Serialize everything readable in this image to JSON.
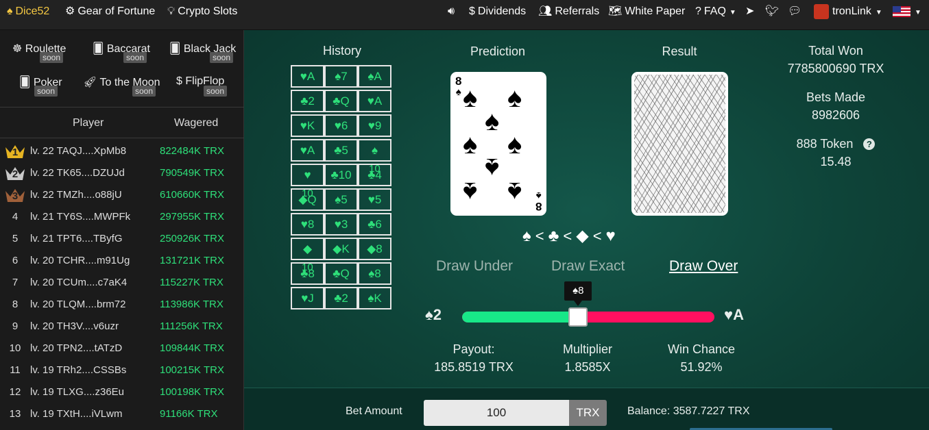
{
  "nav": {
    "brand": "Dice52",
    "gear": "Gear of Fortune",
    "crypto": "Crypto Slots",
    "dividends": "Dividends",
    "referrals": "Referrals",
    "whitepaper": "White Paper",
    "faq": "FAQ",
    "wallet": "tronLink"
  },
  "games": [
    {
      "label": "Roulette",
      "badge": "soon"
    },
    {
      "label": "Baccarat",
      "badge": "soon"
    },
    {
      "label": "Black Jack",
      "badge": "soon"
    },
    {
      "label": "Poker",
      "badge": "soon"
    },
    {
      "label": "To the Moon",
      "badge": "soon"
    },
    {
      "label": "FlipFlop",
      "badge": "soon"
    }
  ],
  "leaderboard": {
    "col_player": "Player",
    "col_wagered": "Wagered",
    "rows": [
      {
        "rank": "1",
        "player": "lv. 22 TAQJ....XpMb8",
        "wagered": "822484K TRX"
      },
      {
        "rank": "2",
        "player": "lv. 22 TK65....DZUJd",
        "wagered": "790549K TRX"
      },
      {
        "rank": "3",
        "player": "lv. 22 TMZh....o88jU",
        "wagered": "610660K TRX"
      },
      {
        "rank": "4",
        "player": "lv. 21 TY6S....MWPFk",
        "wagered": "297955K TRX"
      },
      {
        "rank": "5",
        "player": "lv. 21 TPT6....TByfG",
        "wagered": "250926K TRX"
      },
      {
        "rank": "6",
        "player": "lv. 20 TCHR....m91Ug",
        "wagered": "131721K TRX"
      },
      {
        "rank": "7",
        "player": "lv. 20 TCUm....c7aK4",
        "wagered": "115227K TRX"
      },
      {
        "rank": "8",
        "player": "lv. 20 TLQM....brm72",
        "wagered": "113986K TRX"
      },
      {
        "rank": "9",
        "player": "lv. 20 TH3V....v6uzr",
        "wagered": "111256K TRX"
      },
      {
        "rank": "10",
        "player": "lv. 20 TPN2....tATzD",
        "wagered": "109844K TRX"
      },
      {
        "rank": "11",
        "player": "lv. 19 TRh2....CSSBs",
        "wagered": "100215K TRX"
      },
      {
        "rank": "12",
        "player": "lv. 19 TLXG....z36Eu",
        "wagered": "100198K TRX"
      },
      {
        "rank": "13",
        "player": "lv. 19 TXtH....iVLwm",
        "wagered": "91166K TRX"
      }
    ]
  },
  "history": {
    "title": "History",
    "cells": [
      "♥A",
      "♠7",
      "♠A",
      "♣2",
      "♣Q",
      "♥A",
      "♥K",
      "♥6",
      "♥9",
      "♥A",
      "♣5",
      "♠",
      "♥",
      "♣10",
      "♣4",
      "◆Q",
      "♠5",
      "♥5",
      "♥8",
      "♥3",
      "♣6",
      "◆",
      "◆K",
      "◆8",
      "♣8",
      "♣Q",
      "♠8",
      "♥J",
      "♣2",
      "♠K"
    ],
    "overflow": [
      {
        "cell": 11,
        "text": "10"
      },
      {
        "cell": 12,
        "text": "10"
      },
      {
        "cell": 21,
        "text": "10"
      }
    ]
  },
  "prediction": {
    "title": "Prediction",
    "rank": "8",
    "suit": "♠"
  },
  "result": {
    "title": "Result"
  },
  "stats": {
    "total_won_label": "Total Won",
    "total_won": "7785800690 TRX",
    "bets_label": "Bets Made",
    "bets": "8982606",
    "token_label": "888 Token",
    "token": "15.48"
  },
  "suit_order": [
    "♠",
    "<",
    "♣",
    "<",
    "◆",
    "<",
    "♥"
  ],
  "draw": {
    "under": "Draw Under",
    "exact": "Draw Exact",
    "over": "Draw Over",
    "selected": "over"
  },
  "slider": {
    "min_label": "♠2",
    "max_label": "♥A",
    "value_label": "♠8",
    "position": 0.46
  },
  "outcome": {
    "payout_label": "Payout:",
    "payout": "185.8519 TRX",
    "multiplier_label": "Multiplier",
    "multiplier": "1.8585X",
    "chance_label": "Win Chance",
    "chance": "51.92%"
  },
  "bet": {
    "label": "Bet Amount",
    "amount": "100",
    "unit": "TRX",
    "balance": "Balance: 3587.7227 TRX"
  },
  "colors": {
    "green": "#2ee07a",
    "pink": "#ff1060",
    "bg": "#0d3b33"
  }
}
